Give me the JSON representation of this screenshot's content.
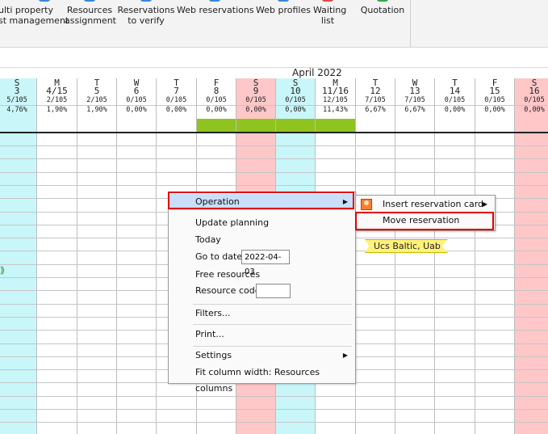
{
  "ribbon": {
    "buttons": [
      {
        "label": "ulti property\nst management",
        "icon_color": "#3a86d8"
      },
      {
        "label": "Resources\nassignment",
        "icon_color": "#3a86d8"
      },
      {
        "label": "Reservations\nto verify",
        "icon_color": "#3a86d8"
      },
      {
        "label": "Web reservations",
        "icon_color": "#3a86d8"
      },
      {
        "label": "Web profiles",
        "icon_color": "#3a86d8"
      },
      {
        "label": "Waiting\nlist",
        "icon_color": "#e04a4a"
      },
      {
        "label": "Quotation",
        "icon_color": "#3aa84a"
      }
    ]
  },
  "calendar": {
    "month": "April 2022",
    "days": [
      {
        "dow": "S",
        "day": "3",
        "occ": "5/105",
        "pct": "4,76%",
        "type": "sun",
        "green": false
      },
      {
        "dow": "M",
        "day": "4/15",
        "occ": "2/105",
        "pct": "1,90%",
        "type": "week",
        "green": false
      },
      {
        "dow": "T",
        "day": "5",
        "occ": "2/105",
        "pct": "1,90%",
        "type": "week",
        "green": false
      },
      {
        "dow": "W",
        "day": "6",
        "occ": "0/105",
        "pct": "0,00%",
        "type": "week",
        "green": false
      },
      {
        "dow": "T",
        "day": "7",
        "occ": "0/105",
        "pct": "0,00%",
        "type": "week",
        "green": false
      },
      {
        "dow": "F",
        "day": "8",
        "occ": "0/105",
        "pct": "0,00%",
        "type": "week",
        "green": true
      },
      {
        "dow": "S",
        "day": "9",
        "occ": "0/105",
        "pct": "0,00%",
        "type": "sat",
        "green": true
      },
      {
        "dow": "S",
        "day": "10",
        "occ": "0/105",
        "pct": "0,00%",
        "type": "sun",
        "green": true
      },
      {
        "dow": "M",
        "day": "11/16",
        "occ": "12/105",
        "pct": "11,43%",
        "type": "week",
        "green": true
      },
      {
        "dow": "T",
        "day": "12",
        "occ": "7/105",
        "pct": "6,67%",
        "type": "week",
        "green": false
      },
      {
        "dow": "W",
        "day": "13",
        "occ": "7/105",
        "pct": "6,67%",
        "type": "week",
        "green": false
      },
      {
        "dow": "T",
        "day": "14",
        "occ": "0/105",
        "pct": "0,00%",
        "type": "week",
        "green": false
      },
      {
        "dow": "F",
        "day": "15",
        "occ": "0/105",
        "pct": "0,00%",
        "type": "week",
        "green": false
      },
      {
        "dow": "S",
        "day": "16",
        "occ": "0/105",
        "pct": "0,00%",
        "type": "sat",
        "green": false
      }
    ],
    "reservation_label": "Ucs Baltic, Uab",
    "colors": {
      "saturday": "#ffc7c7",
      "sunday": "#c9f6f9",
      "occupancy_bar": "#8fc31f",
      "reservation": "#fff27a"
    }
  },
  "context_menu": {
    "operation": "Operation",
    "update_planning": "Update planning",
    "today": "Today",
    "go_to_date": "Go to date",
    "go_to_date_value": "2022-04-03",
    "free_resources": "Free resources",
    "resource_code": "Resource code",
    "filters": "Filters...",
    "print": "Print...",
    "settings": "Settings",
    "fit_column_width": "Fit column width: Resources columns"
  },
  "submenu": {
    "insert_reservation_card": "Insert reservation card",
    "move_reservation": "Move reservation"
  },
  "highlight_color": "#e00000"
}
